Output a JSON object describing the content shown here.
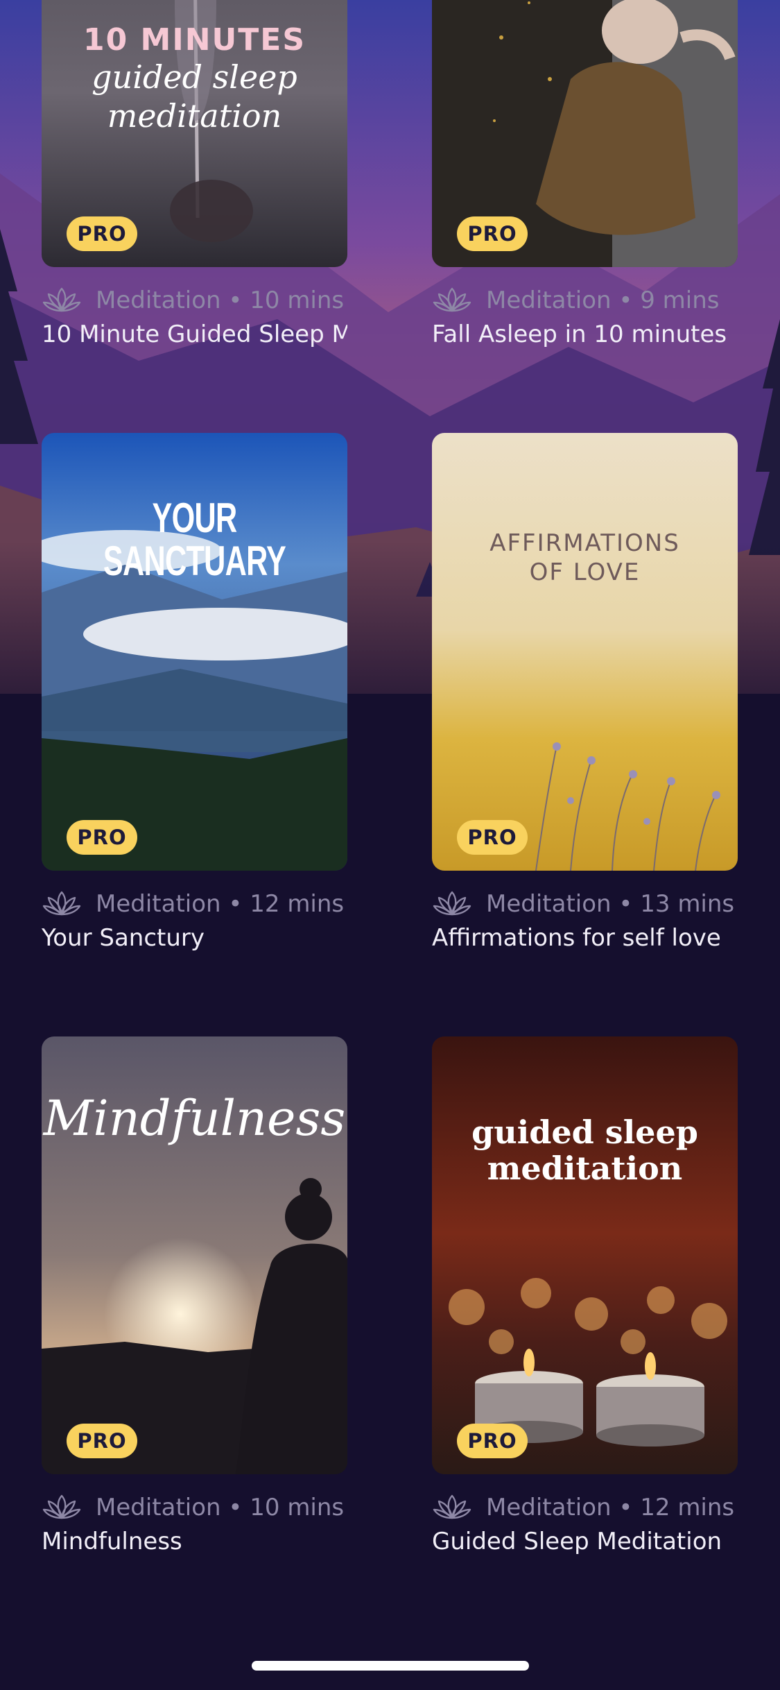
{
  "cards": [
    {
      "cover_lines": [
        "10 MINUTES",
        "guided sleep",
        "meditation"
      ],
      "badge": "PRO",
      "category": "Meditation",
      "duration": "10 mins",
      "meta": "Meditation • 10 mins",
      "title": "10 Minute Guided Sleep M"
    },
    {
      "cover_lines": [],
      "badge": "PRO",
      "category": "Meditation",
      "duration": "9 mins",
      "meta": "Meditation • 9 mins",
      "title": "Fall Asleep in 10 minutes"
    },
    {
      "cover_lines": [
        "YOUR",
        "SANCTUARY"
      ],
      "badge": "PRO",
      "category": "Meditation",
      "duration": "12 mins",
      "meta": "Meditation • 12 mins",
      "title": "Your Sanctury"
    },
    {
      "cover_lines": [
        "AFFIRMATIONS",
        "OF LOVE"
      ],
      "badge": "PRO",
      "category": "Meditation",
      "duration": "13 mins",
      "meta": "Meditation • 13 mins",
      "title": "Affirmations for self love"
    },
    {
      "cover_lines": [
        "Mindfulness"
      ],
      "badge": "PRO",
      "category": "Meditation",
      "duration": "10 mins",
      "meta": "Meditation • 10 mins",
      "title": "Mindfulness"
    },
    {
      "cover_lines": [
        "guided sleep",
        "meditation"
      ],
      "badge": "PRO",
      "category": "Meditation",
      "duration": "12 mins",
      "meta": "Meditation • 12 mins",
      "title": "Guided Sleep Meditation"
    }
  ],
  "icons": {
    "category": "lotus-icon"
  },
  "colors": {
    "background": "#150f2e",
    "pro_badge": "#f9d25e",
    "pro_text": "#1d1a3a",
    "meta_text": "#8e88a6",
    "title_text": "#f2eff8"
  }
}
